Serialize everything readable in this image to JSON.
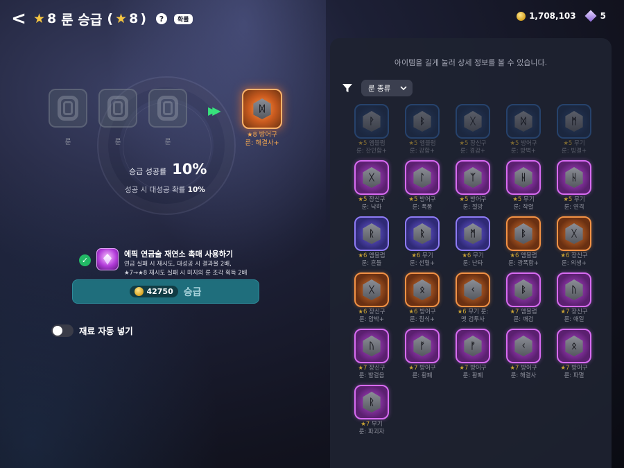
{
  "header": {
    "back_glyph": "<",
    "title_tier": "8",
    "title_text": "룬 승급",
    "title_paren_tier": "8",
    "help_glyph": "?",
    "prob_chip": "확률"
  },
  "currency": {
    "gold": "1,708,103",
    "gems": "5"
  },
  "slots": [
    {
      "label": "룬"
    },
    {
      "label": "룬"
    },
    {
      "label": "룬"
    }
  ],
  "target": {
    "rune": "ᛞ",
    "tier_line": "★8 방어구",
    "name_line": "룬: 해결사+"
  },
  "rate": {
    "label": "승급 성공률",
    "value": "10%"
  },
  "great_success": {
    "prefix": "성공 시 대성공 확률 ",
    "value": "10%"
  },
  "epic": {
    "title": "에픽 연금술 재연소 촉매 사용하기",
    "desc1": "연금 실패 시 재시도, 대성공 시 결과물 2배,",
    "desc2": "★7→★8 재시도 실패 시 미지의 룬 조각 획득 2배"
  },
  "upgrade": {
    "cost": "42750",
    "label": "승급"
  },
  "auto_fill": {
    "label": "재료 자동 넣기",
    "on": false
  },
  "right": {
    "hint": "아이템을 길게 눌러 상세 정보를 볼 수 있습니다.",
    "dropdown": "룬 종류"
  },
  "runes": [
    {
      "tier": "★5",
      "cat": "엠블럼",
      "name": "룬: 잔인함+",
      "glyph": "ᚹ",
      "grade": "blue",
      "faded": true
    },
    {
      "tier": "★5",
      "cat": "엠블럼",
      "name": "룬: 강함+",
      "glyph": "ᛒ",
      "grade": "blue",
      "faded": true
    },
    {
      "tier": "★5",
      "cat": "장신구",
      "name": "룬: 경감+",
      "glyph": "ᚷ",
      "grade": "blue",
      "faded": true
    },
    {
      "tier": "★5",
      "cat": "방어구",
      "name": "룬: 방벽+",
      "glyph": "ᛞ",
      "grade": "blue",
      "faded": true
    },
    {
      "tier": "★5",
      "cat": "무기",
      "name": "룬: 빙결+",
      "glyph": "ᛗ",
      "grade": "blue",
      "faded": true
    },
    {
      "tier": "★5",
      "cat": "장신구",
      "name": "룬: 낙하",
      "glyph": "ᚷ",
      "grade": "purple",
      "faded": false
    },
    {
      "tier": "★5",
      "cat": "방어구",
      "name": "룬: 폭풍",
      "glyph": "ᛚ",
      "grade": "purple",
      "faded": false
    },
    {
      "tier": "★5",
      "cat": "방어구",
      "name": "룬: 절망",
      "glyph": "ᛉ",
      "grade": "purple",
      "faded": false
    },
    {
      "tier": "★5",
      "cat": "무기",
      "name": "룬: 작렬",
      "glyph": "ᚺ",
      "grade": "purple",
      "faded": false
    },
    {
      "tier": "★5",
      "cat": "무기",
      "name": "룬: 연격",
      "glyph": "ᚺ",
      "grade": "purple",
      "faded": false
    },
    {
      "tier": "★6",
      "cat": "엠블럼",
      "name": "룬: 흔들",
      "glyph": "ᚱ",
      "grade": "violet",
      "faded": false
    },
    {
      "tier": "★6",
      "cat": "무기",
      "name": "룬: 선혈+",
      "glyph": "ᚱ",
      "grade": "violet",
      "faded": false
    },
    {
      "tier": "★6",
      "cat": "무기",
      "name": "룬: 난타",
      "glyph": "ᛗ",
      "grade": "violet",
      "faded": false
    },
    {
      "tier": "★6",
      "cat": "엠블럼",
      "name": "룬: 광폭함+",
      "glyph": "ᛒ",
      "grade": "orange",
      "faded": false
    },
    {
      "tier": "★6",
      "cat": "장신구",
      "name": "룬: 의생+",
      "glyph": "ᚷ",
      "grade": "orange",
      "faded": false
    },
    {
      "tier": "★6",
      "cat": "장신구",
      "name": "룬: 압박+",
      "glyph": "ᚷ",
      "grade": "orange",
      "faded": false
    },
    {
      "tier": "★6",
      "cat": "방어구",
      "name": "룬: 침식+",
      "glyph": "ᛟ",
      "grade": "orange",
      "faded": false
    },
    {
      "tier": "★6",
      "cat": "무기 룬:",
      "name": "맷 검투사",
      "glyph": "ᚲ",
      "grade": "orange",
      "faded": false
    },
    {
      "tier": "★7",
      "cat": "엠블럼",
      "name": "룬: 깨검",
      "glyph": "ᛒ",
      "grade": "purple",
      "faded": false
    },
    {
      "tier": "★7",
      "cat": "장신구",
      "name": "룬: 애일",
      "glyph": "ᚢ",
      "grade": "purple",
      "faded": false
    },
    {
      "tier": "★7",
      "cat": "장신구",
      "name": "룬: 발걸음",
      "glyph": "ᚢ",
      "grade": "purple",
      "faded": false
    },
    {
      "tier": "★7",
      "cat": "방어구",
      "name": "룬: 황폐",
      "glyph": "ᚠ",
      "grade": "purple",
      "faded": false
    },
    {
      "tier": "★7",
      "cat": "방어구",
      "name": "룬: 황폐",
      "glyph": "ᚠ",
      "grade": "purple",
      "faded": false
    },
    {
      "tier": "★7",
      "cat": "방어구",
      "name": "룬: 해결사",
      "glyph": "ᚲ",
      "grade": "purple",
      "faded": false
    },
    {
      "tier": "★7",
      "cat": "방어구",
      "name": "룬: 파멸",
      "glyph": "ᛟ",
      "grade": "purple",
      "faded": false
    },
    {
      "tier": "★7",
      "cat": "무기",
      "name": "룬: 파괴자",
      "glyph": "ᚱ",
      "grade": "purple",
      "faded": false
    }
  ]
}
